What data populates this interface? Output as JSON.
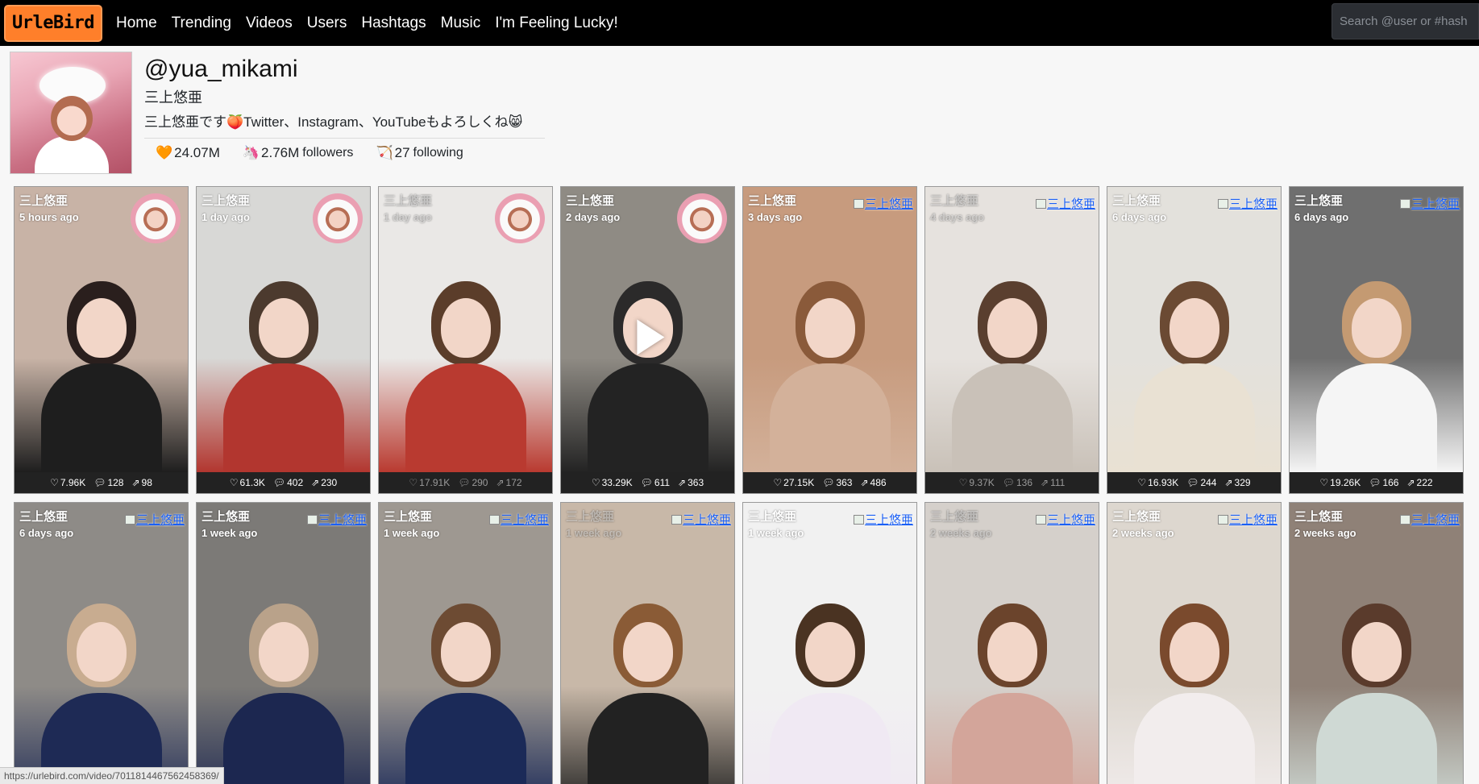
{
  "navbar": {
    "brand": "UrleBird",
    "links": [
      "Home",
      "Trending",
      "Videos",
      "Users",
      "Hashtags",
      "Music",
      "I'm Feeling Lucky!"
    ],
    "search_placeholder": "Search @user or #hash"
  },
  "profile": {
    "username": "@yua_mikami",
    "nickname": "三上悠亜",
    "bio": "三上悠亜です🍑Twitter、Instagram、YouTubeもよろしくね😸",
    "likes": "24.07M",
    "followers": "2.76M",
    "followers_label": "followers",
    "following": "27",
    "following_label": "following",
    "icons": {
      "likes": "🧡",
      "followers": "🦄",
      "following": "🏹"
    }
  },
  "videos": [
    {
      "title": "三上悠亜",
      "time": "5 hours ago",
      "likes": "7.96K",
      "comments": "128",
      "shares": "98",
      "avatar": "image",
      "dim": false
    },
    {
      "title": "三上悠亜",
      "time": "1 day ago",
      "likes": "61.3K",
      "comments": "402",
      "shares": "230",
      "avatar": "image",
      "dim": false
    },
    {
      "title": "三上悠亜",
      "time": "1 day ago",
      "likes": "17.91K",
      "comments": "290",
      "shares": "172",
      "avatar": "image",
      "dim": true
    },
    {
      "title": "三上悠亜",
      "time": "2 days ago",
      "likes": "33.29K",
      "comments": "611",
      "shares": "363",
      "avatar": "image",
      "dim": false,
      "hover": true
    },
    {
      "title": "三上悠亜",
      "time": "3 days ago",
      "likes": "27.15K",
      "comments": "363",
      "shares": "486",
      "avatar": "broken",
      "dim": false
    },
    {
      "title": "三上悠亜",
      "time": "4 days ago",
      "likes": "9.37K",
      "comments": "136",
      "shares": "111",
      "avatar": "broken",
      "dim": true
    },
    {
      "title": "三上悠亜",
      "time": "6 days ago",
      "likes": "16.93K",
      "comments": "244",
      "shares": "329",
      "avatar": "broken",
      "dim": false
    },
    {
      "title": "三上悠亜",
      "time": "6 days ago",
      "likes": "19.26K",
      "comments": "166",
      "shares": "222",
      "avatar": "broken",
      "dim": false
    },
    {
      "title": "三上悠亜",
      "time": "6 days ago",
      "avatar": "broken",
      "dim": false
    },
    {
      "title": "三上悠亜",
      "time": "1 week ago",
      "avatar": "broken",
      "dim": false
    },
    {
      "title": "三上悠亜",
      "time": "1 week ago",
      "avatar": "broken",
      "dim": false
    },
    {
      "title": "三上悠亜",
      "time": "1 week ago",
      "avatar": "broken",
      "dim": true
    },
    {
      "title": "三上悠亜",
      "time": "1 week ago",
      "avatar": "broken",
      "dim": false
    },
    {
      "title": "三上悠亜",
      "time": "2 weeks ago",
      "avatar": "broken",
      "dim": true
    },
    {
      "title": "三上悠亜",
      "time": "2 weeks ago",
      "avatar": "broken",
      "dim": false
    },
    {
      "title": "三上悠亜",
      "time": "2 weeks ago",
      "avatar": "broken",
      "dim": false
    }
  ],
  "broken_alt": "三上悠亜",
  "statusbar": "https://urlebird.com/video/7011814467562458369/"
}
